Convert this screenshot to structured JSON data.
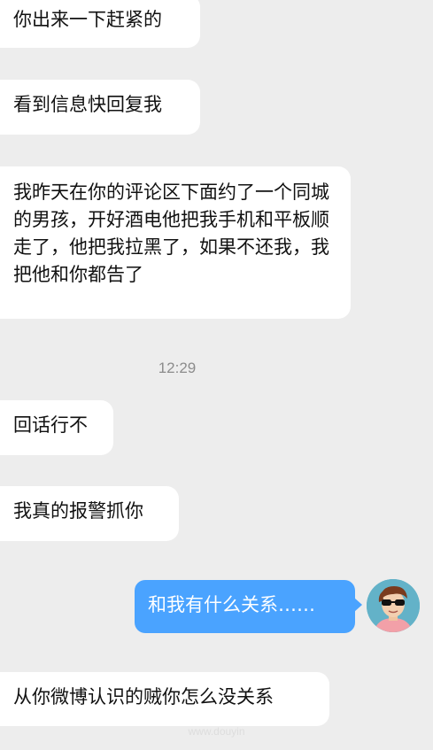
{
  "colors": {
    "background": "#ededed",
    "incoming_bubble": "#ffffff",
    "outgoing_bubble": "#4aa3ff",
    "timestamp_text": "#8c8c8c"
  },
  "conversation": {
    "messages": [
      {
        "direction": "incoming",
        "text": "你出来一下赶紧的"
      },
      {
        "direction": "incoming",
        "text": "看到信息快回复我"
      },
      {
        "direction": "incoming",
        "text": "我昨天在你的评论区下面约了一个同城的男孩，开好酒电他把我手机和平板顺走了，他把我拉黑了，如果不还我，我把他和你都告了"
      },
      {
        "direction": "incoming",
        "text": "回话行不"
      },
      {
        "direction": "incoming",
        "text": "我真的报警抓你"
      },
      {
        "direction": "outgoing",
        "text": "和我有什么关系……"
      },
      {
        "direction": "incoming",
        "text": "从你微博认识的贼你怎么没关系"
      }
    ],
    "timestamp": "12:29"
  },
  "avatar": {
    "icon": "cartoon-avatar-icon"
  },
  "watermark": {
    "text": "www.douyin"
  }
}
